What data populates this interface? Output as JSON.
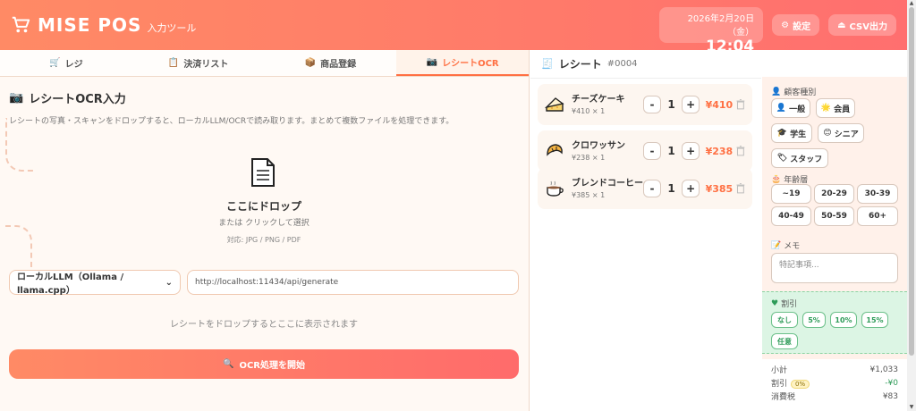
{
  "header": {
    "title": "MISE POS",
    "subtitle": "入力ツール",
    "date": "2026年2月20日（金）",
    "time": "12:04",
    "settings_label": "設定",
    "csv_label": "CSV出力"
  },
  "tabs": [
    {
      "label": "レジ",
      "icon": "register-icon"
    },
    {
      "label": "決済リスト",
      "icon": "clipboard-icon"
    },
    {
      "label": "商品登録",
      "icon": "box-icon"
    },
    {
      "label": "レシートOCR",
      "icon": "camera-icon",
      "active": true
    }
  ],
  "ocr": {
    "title": "レシートOCR入力",
    "description": "レシートの写真・スキャンをドロップすると、ローカルLLM/OCRで読み取ります。まとめて複数ファイルを処理できます。",
    "drop_main": "ここにドロップ",
    "drop_sub": "または クリックして選択",
    "drop_types": "対応: JPG / PNG / PDF",
    "engine_selected": "ローカルLLM（Ollama / llama.cpp）",
    "endpoint": "http://localhost:11434/api/generate",
    "result_hint": "レシートをドロップするとここに表示されます",
    "start_label": "OCR処理を開始"
  },
  "receipt": {
    "title": "レシート",
    "number": "#0004",
    "items": [
      {
        "name": "チーズケーキ",
        "price": "¥410 × 1",
        "qty": "1",
        "total": "¥410",
        "icon": "cake-icon"
      },
      {
        "name": "クロワッサン",
        "price": "¥238 × 1",
        "qty": "1",
        "total": "¥238",
        "icon": "croissant-icon"
      },
      {
        "name": "ブレンドコーヒー",
        "price": "¥385 × 1",
        "qty": "1",
        "total": "¥385",
        "icon": "coffee-icon"
      }
    ],
    "minus": "-",
    "plus": "+"
  },
  "customer": {
    "type_label": "顧客種別",
    "types": [
      "一般",
      "会員",
      "学生",
      "シニア",
      "スタッフ"
    ],
    "age_label": "年齢層",
    "ages": [
      "~19",
      "20-29",
      "30-39",
      "40-49",
      "50-59",
      "60+"
    ],
    "memo_label": "メモ",
    "memo_placeholder": "特記事項...",
    "discount_label": "割引",
    "discounts": [
      "なし",
      "5%",
      "10%",
      "15%",
      "任意"
    ]
  },
  "summary": {
    "subtotal_label": "小計",
    "subtotal": "¥1,033",
    "discount_label": "割引",
    "discount_badge": "0%",
    "discount_value": "-¥0",
    "tax_label": "消費税",
    "tax": "¥83"
  },
  "colors": {
    "accent": "#ff7043",
    "header_start": "#ff8a65",
    "header_end": "#ff6f6f",
    "discount": "#2e9b58"
  }
}
